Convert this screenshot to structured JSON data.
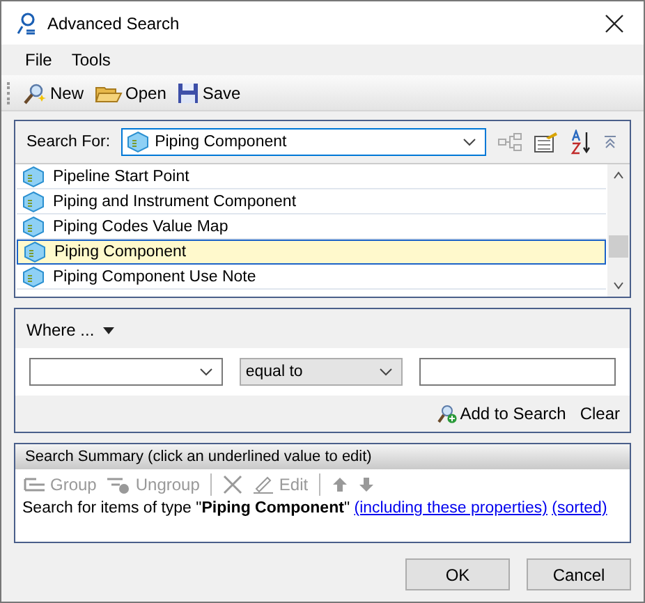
{
  "window": {
    "title": "Advanced Search"
  },
  "menu": [
    "File",
    "Tools"
  ],
  "toolbar": [
    {
      "kind": "new",
      "label": "New"
    },
    {
      "kind": "open",
      "label": "Open"
    },
    {
      "kind": "save",
      "label": "Save"
    }
  ],
  "search": {
    "label": "Search For:",
    "value": "Piping Component",
    "items": [
      {
        "label": "Pipeline Start Point",
        "selected": false
      },
      {
        "label": "Piping and Instrument Component",
        "selected": false
      },
      {
        "label": "Piping Codes Value Map",
        "selected": false
      },
      {
        "label": "Piping Component",
        "selected": true
      },
      {
        "label": "Piping Component Use Note",
        "selected": false
      }
    ]
  },
  "where": {
    "title": "Where ...",
    "operator": "equal to",
    "add_label": "Add to Search",
    "clear_label": "Clear"
  },
  "summary": {
    "title": "Search Summary (click an underlined value to edit)",
    "tools": [
      {
        "kind": "group",
        "label": "Group",
        "disabled": true
      },
      {
        "kind": "ungroup",
        "label": "Ungroup",
        "disabled": true
      },
      {
        "kind": "sep"
      },
      {
        "kind": "delete",
        "disabled": true
      },
      {
        "kind": "edit",
        "label": "Edit",
        "disabled": true
      },
      {
        "kind": "sep"
      },
      {
        "kind": "up",
        "disabled": true
      },
      {
        "kind": "down",
        "disabled": true
      }
    ],
    "text": "Search for items of type \"**Piping Component**\"",
    "links": [
      "(including these properties)",
      "(sorted)"
    ]
  },
  "buttons": [
    "OK",
    "Cancel"
  ]
}
